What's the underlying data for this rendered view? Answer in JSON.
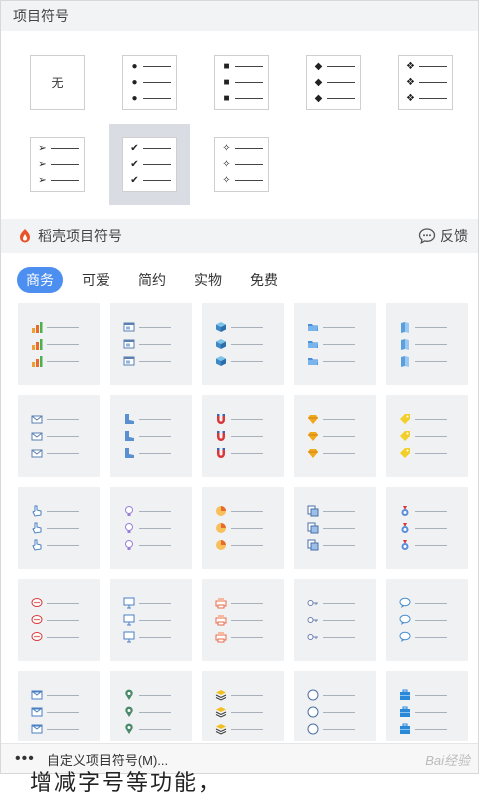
{
  "panel": {
    "title": "项目符号",
    "basic": {
      "none_label": "无",
      "items": [
        {
          "name": "none-bullet",
          "symbol": "none"
        },
        {
          "name": "circle-bullet",
          "symbol": "●"
        },
        {
          "name": "square-bullet",
          "symbol": "■"
        },
        {
          "name": "diamond-bullet",
          "symbol": "◆"
        },
        {
          "name": "four-diamond-bullet",
          "symbol": "❖"
        },
        {
          "name": "arrowhead-bullet",
          "symbol": "➢"
        },
        {
          "name": "checkmark-bullet",
          "symbol": "✔",
          "selected": true
        },
        {
          "name": "star-bullet",
          "symbol": "✧"
        }
      ]
    },
    "daoke": {
      "title": "稻壳项目符号",
      "feedback": "反馈",
      "brand_color": "#e8532a"
    },
    "tabs": [
      {
        "label": "商务",
        "active": true
      },
      {
        "label": "可爱"
      },
      {
        "label": "简约"
      },
      {
        "label": "实物"
      },
      {
        "label": "免费"
      }
    ],
    "accent_color": "#4c8ff0",
    "templates": [
      {
        "name": "bar-chart-icon"
      },
      {
        "name": "window-icon"
      },
      {
        "name": "cube-icon"
      },
      {
        "name": "folder-icon"
      },
      {
        "name": "book-icon"
      },
      {
        "name": "envelope-icon"
      },
      {
        "name": "boot-icon"
      },
      {
        "name": "magnet-icon"
      },
      {
        "name": "gem-icon"
      },
      {
        "name": "tag-icon"
      },
      {
        "name": "hand-pointer-icon"
      },
      {
        "name": "lightbulb-icon"
      },
      {
        "name": "pie-chart-icon"
      },
      {
        "name": "document-stack-icon"
      },
      {
        "name": "medal-icon"
      },
      {
        "name": "chat-bubble-icon"
      },
      {
        "name": "monitor-icon"
      },
      {
        "name": "printer-icon"
      },
      {
        "name": "key-icon"
      },
      {
        "name": "speech-bubble-icon"
      },
      {
        "name": "mail-icon"
      },
      {
        "name": "location-pin-icon"
      },
      {
        "name": "layers-icon"
      },
      {
        "name": "clock-icon"
      },
      {
        "name": "briefcase-icon"
      }
    ],
    "footer": {
      "label": "自定义项目符号(M)...",
      "watermark": "Bai经验"
    }
  },
  "background_text": "增减字号等功能，"
}
